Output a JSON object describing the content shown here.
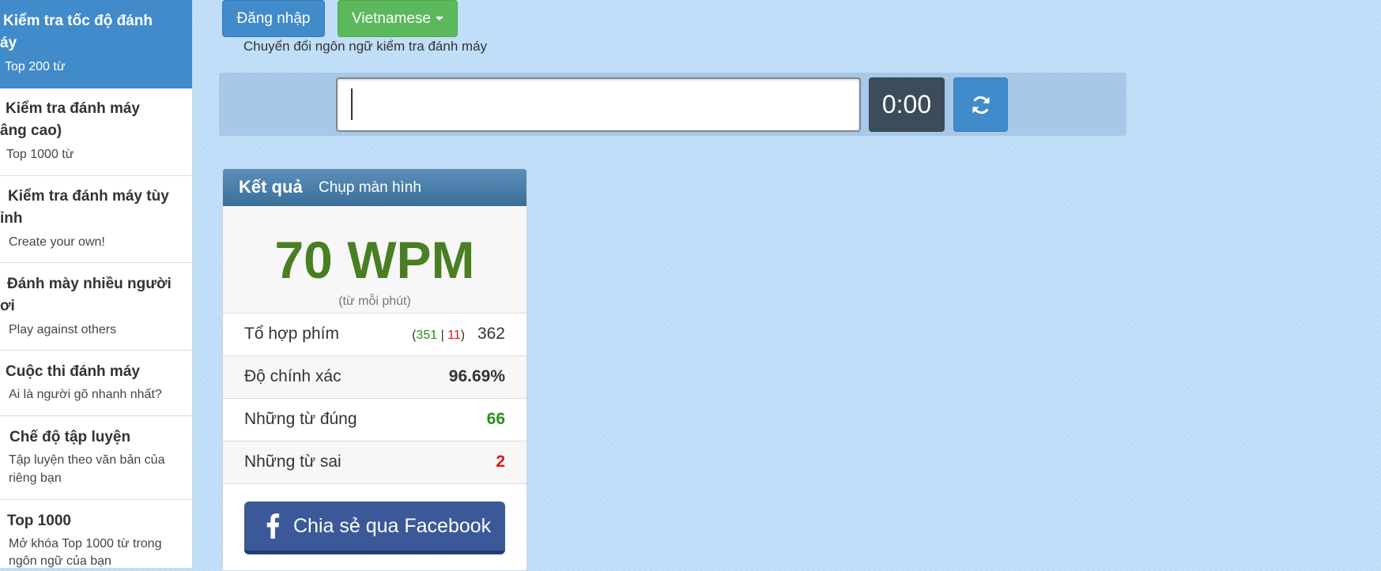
{
  "sidebar": {
    "items": [
      {
        "title_line1": "Kiểm tra tốc độ đánh",
        "title_line2": "áy",
        "sub_line1": "Top 200 từ",
        "sub_line2": ""
      },
      {
        "title_line1": "Kiểm tra đánh máy",
        "title_line2": "âng cao)",
        "sub_line1": "Top 1000 từ",
        "sub_line2": ""
      },
      {
        "title_line1": "Kiểm tra đánh máy tùy",
        "title_line2": "ỉnh",
        "sub_line1": "Create your own!",
        "sub_line2": ""
      },
      {
        "title_line1": "Đánh mày nhiều người",
        "title_line2": "ơi",
        "sub_line1": "Play against others",
        "sub_line2": ""
      },
      {
        "title_line1": "Cuộc thi đánh máy",
        "title_line2": "",
        "sub_line1": "Ai là người gõ nhanh nhất?",
        "sub_line2": ""
      },
      {
        "title_line1": "Chế độ tập luyện",
        "title_line2": "",
        "sub_line1": "Tập luyện theo văn bản của",
        "sub_line2": "riêng bạn"
      },
      {
        "title_line1": "Top 1000",
        "title_line2": "",
        "sub_line1": "Mở khóa Top 1000 từ trong",
        "sub_line2": "ngôn ngữ của bạn"
      }
    ]
  },
  "header": {
    "login_label": "Đăng nhập",
    "language_label": "Vietnamese",
    "language_hint": "Chuyển đổi ngôn ngữ kiểm tra đánh máy"
  },
  "typing": {
    "input_value": "",
    "timer": "0:00",
    "reload_icon": "refresh-icon"
  },
  "results": {
    "title": "Kết quả",
    "screenshot_label": "Chụp màn hình",
    "wpm": "70 WPM",
    "wpm_sub": "(từ mỗi phút)",
    "keystrokes_label": "Tổ hợp phím",
    "keystrokes_open": "(",
    "keystrokes_correct": "351",
    "keystrokes_sep": " | ",
    "keystrokes_wrong": "11",
    "keystrokes_close": ")",
    "keystrokes_total": "362",
    "accuracy_label": "Độ chính xác",
    "accuracy_value": "96.69%",
    "correct_words_label": "Những từ đúng",
    "correct_words_value": "66",
    "wrong_words_label": "Những từ sai",
    "wrong_words_value": "2",
    "share_label": "Chia sẻ qua Facebook"
  },
  "colors": {
    "primary": "#428bca",
    "success": "#5cb85c",
    "wpm_green": "#4a7e23",
    "correct_green": "#2e8b1f",
    "error_red": "#e0141e",
    "facebook": "#3b5998",
    "timer_bg": "#3c4c5a"
  }
}
